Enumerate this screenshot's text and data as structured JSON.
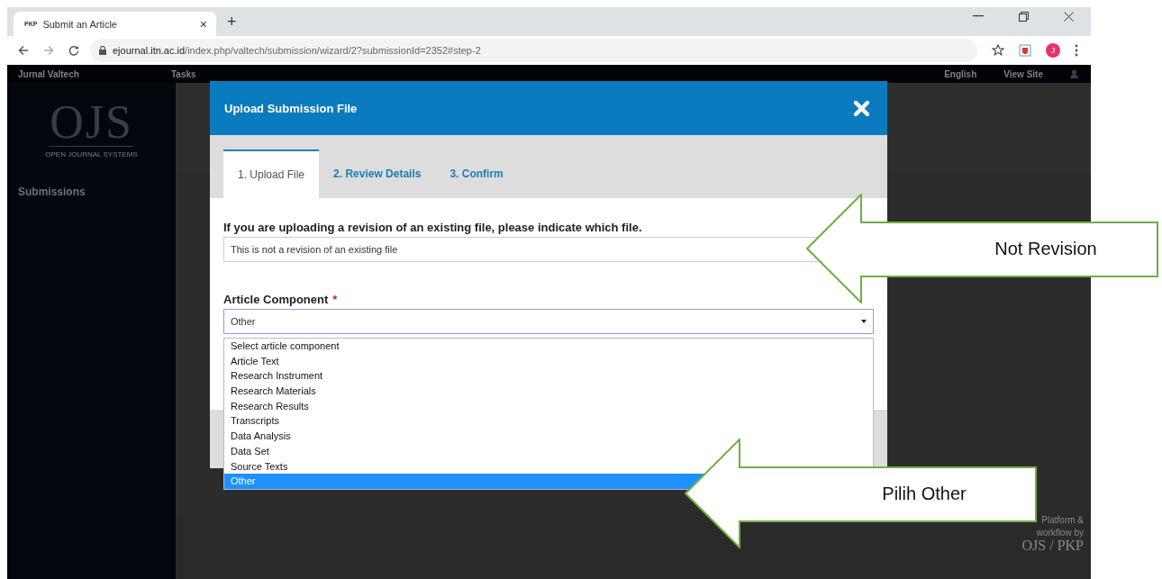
{
  "browser": {
    "tab": {
      "favicon_text": "PKP",
      "title": "Submit an Article",
      "close": "×"
    },
    "new_tab": "+",
    "url": {
      "host": "ejournal.itn.ac.id",
      "path": "/index.php/valtech/submission/wizard/2?submissionId=2352#step-2"
    },
    "profile_initial": "J"
  },
  "app": {
    "site_title": "Jurnal Valtech",
    "tasks_label": "Tasks",
    "language": "English",
    "view_site": "View Site",
    "logo": "OJS",
    "logo_subtitle": "OPEN JOURNAL SYSTEMS",
    "sidebar": [
      {
        "label": "Submissions"
      }
    ],
    "footer": [
      "Platform &",
      "workflow by",
      "OJS / PKP"
    ]
  },
  "modal": {
    "title": "Upload Submission File",
    "steps": [
      {
        "label": "1. Upload File",
        "selected": true
      },
      {
        "label": "2. Review Details",
        "selected": false
      },
      {
        "label": "3. Confirm",
        "selected": false
      }
    ],
    "revision_question": "If you are uploading a revision of an existing file, please indicate which file.",
    "revision_value": "This is not a revision of an existing file",
    "component_label": "Article Component",
    "required_mark": "*",
    "component_value": "Other",
    "options": [
      {
        "label": "Select article component",
        "selected": false
      },
      {
        "label": "Article Text",
        "selected": false
      },
      {
        "label": "Research Instrument",
        "selected": false
      },
      {
        "label": "Research Materials",
        "selected": false
      },
      {
        "label": "Research Results",
        "selected": false
      },
      {
        "label": "Transcripts",
        "selected": false
      },
      {
        "label": "Data Analysis",
        "selected": false
      },
      {
        "label": "Data Set",
        "selected": false
      },
      {
        "label": "Source Texts",
        "selected": false
      },
      {
        "label": "Other",
        "selected": true
      }
    ]
  },
  "annotations": [
    {
      "text": "Not Revision"
    },
    {
      "text": "Pilih Other"
    }
  ]
}
